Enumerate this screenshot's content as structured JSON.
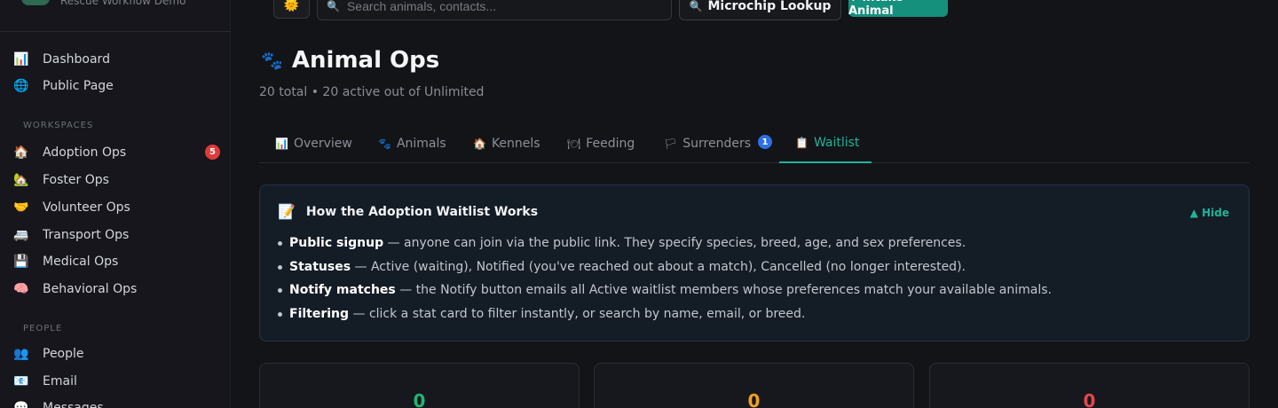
{
  "brand": {
    "subtitle": "Rescue Workflow Demo"
  },
  "sidebar": {
    "top_items": [
      {
        "icon": "📊",
        "label": "Dashboard"
      },
      {
        "icon": "🌐",
        "label": "Public Page"
      }
    ],
    "workspaces_heading": "WORKSPACES",
    "workspaces": [
      {
        "icon": "🏠",
        "label": "Adoption Ops",
        "badge": "5"
      },
      {
        "icon": "🏡",
        "label": "Foster Ops"
      },
      {
        "icon": "🤝",
        "label": "Volunteer Ops"
      },
      {
        "icon": "🚐",
        "label": "Transport Ops"
      },
      {
        "icon": "💾",
        "label": "Medical Ops"
      },
      {
        "icon": "🧠",
        "label": "Behavioral Ops"
      }
    ],
    "people_heading": "PEOPLE",
    "people": [
      {
        "icon": "👥",
        "label": "People"
      },
      {
        "icon": "📧",
        "label": "Email"
      },
      {
        "icon": "💬",
        "label": "Messages"
      }
    ]
  },
  "topbar": {
    "theme_icon": "🌞",
    "search_icon": "🔍",
    "search_placeholder": "Search animals, contacts...",
    "microchip_icon": "🔍",
    "microchip_label": "Microchip Lookup",
    "intake_label": "+ Intake Animal"
  },
  "page": {
    "title_icon": "🐾",
    "title": "Animal Ops",
    "subtitle": "20 total • 20 active out of Unlimited"
  },
  "tabs": [
    {
      "icon": "📊",
      "label": "Overview"
    },
    {
      "icon": "🐾",
      "label": "Animals"
    },
    {
      "icon": "🏠",
      "label": "Kennels"
    },
    {
      "icon": "🍽",
      "label": "Feeding"
    },
    {
      "icon": "🏳",
      "label": "Surrenders",
      "badge": "1"
    },
    {
      "icon": "📋",
      "label": "Waitlist",
      "active": true
    }
  ],
  "info_panel": {
    "icon": "📝",
    "title": "How the Adoption Waitlist Works",
    "hide_label": "▲ Hide",
    "rules": [
      {
        "term": "Public signup",
        "text": " — anyone can join via the public link. They specify species, breed, age, and sex preferences."
      },
      {
        "term": "Statuses",
        "text": " — Active (waiting), Notified (you've reached out about a match), Cancelled (no longer interested)."
      },
      {
        "term": "Notify matches",
        "text": " — the Notify button emails all Active waitlist members whose preferences match your available animals."
      },
      {
        "term": "Filtering",
        "text": " — click a stat card to filter instantly, or search by name, email, or breed."
      }
    ]
  },
  "stats": [
    {
      "value": "0",
      "color": "#22b573"
    },
    {
      "value": "0",
      "color": "#f0a020"
    },
    {
      "value": "0",
      "color": "#e5484d"
    }
  ],
  "colors": {
    "accent": "#1fb39c",
    "danger_badge": "#e03a3a",
    "info_badge": "#2f6fe3"
  }
}
